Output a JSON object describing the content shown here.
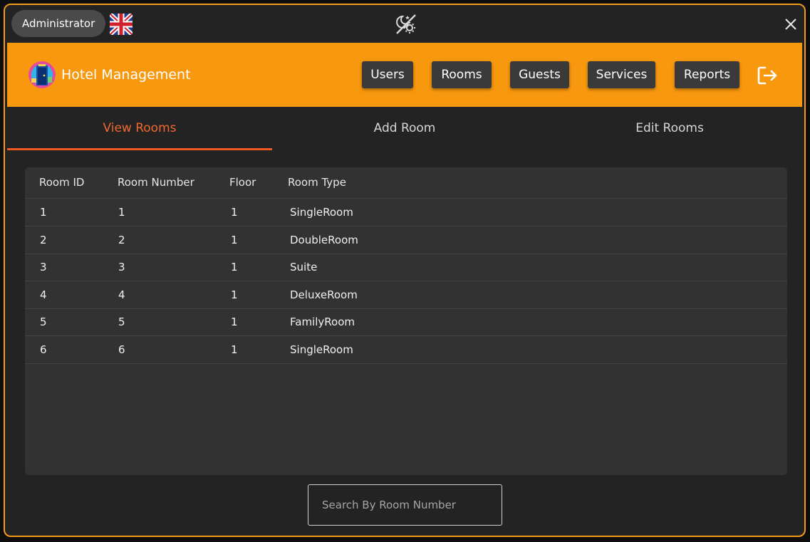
{
  "titlebar": {
    "role": "Administrator",
    "language_icon": "uk-flag-icon",
    "theme_icon": "night-day-toggle-icon",
    "close_icon": "close-icon"
  },
  "header": {
    "app_title": "Hotel Management",
    "logo_icon": "hotel-door-logo",
    "nav": [
      {
        "label": "Users"
      },
      {
        "label": "Rooms"
      },
      {
        "label": "Guests"
      },
      {
        "label": "Services"
      },
      {
        "label": "Reports"
      }
    ],
    "logout_icon": "logout-icon",
    "accent_color": "#f7980f"
  },
  "tabs": [
    {
      "label": "View Rooms",
      "active": true
    },
    {
      "label": "Add Room",
      "active": false
    },
    {
      "label": "Edit Rooms",
      "active": false
    }
  ],
  "rooms_table": {
    "columns": [
      "Room ID",
      "Room Number",
      "Floor",
      "Room Type"
    ],
    "rows": [
      {
        "id": "1",
        "number": "1",
        "floor": "1",
        "type": "SingleRoom"
      },
      {
        "id": "2",
        "number": "2",
        "floor": "1",
        "type": "DoubleRoom"
      },
      {
        "id": "3",
        "number": "3",
        "floor": "1",
        "type": "Suite"
      },
      {
        "id": "4",
        "number": "4",
        "floor": "1",
        "type": "DeluxeRoom"
      },
      {
        "id": "5",
        "number": "5",
        "floor": "1",
        "type": "FamilyRoom"
      },
      {
        "id": "6",
        "number": "6",
        "floor": "1",
        "type": "SingleRoom"
      }
    ]
  },
  "search": {
    "placeholder": "Search By Room Number",
    "value": ""
  }
}
